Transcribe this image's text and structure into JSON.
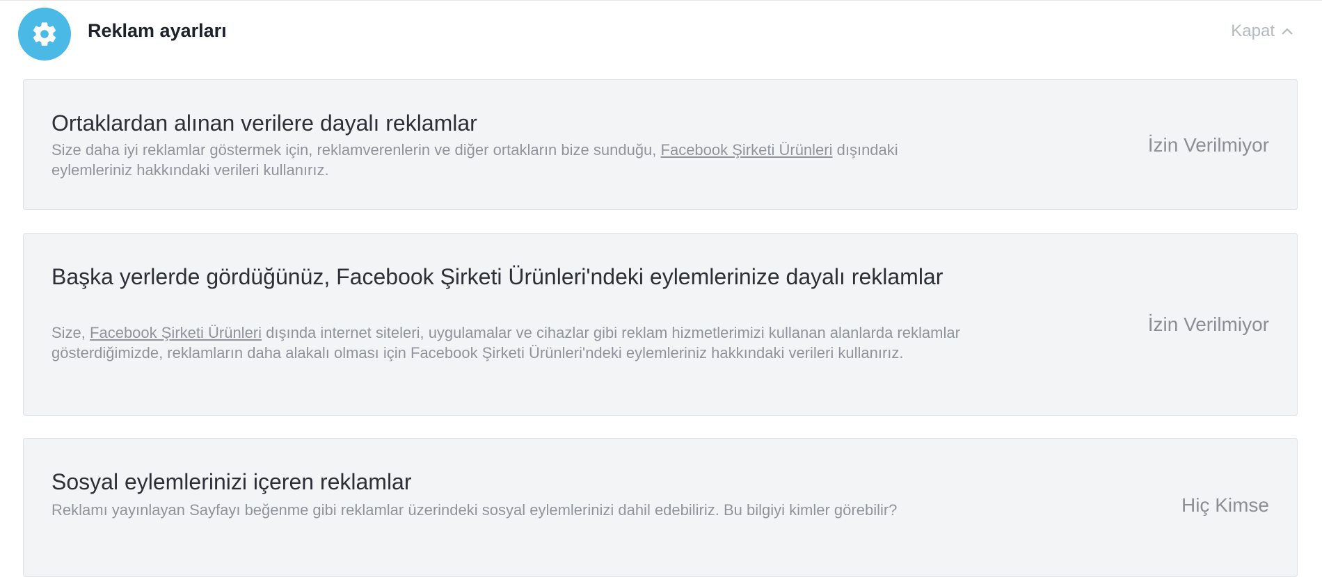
{
  "header": {
    "title": "Reklam ayarları",
    "collapse_label": "Kapat",
    "icon": "gear-icon",
    "accent_color": "#4ab9e6"
  },
  "cards": [
    {
      "title": "Ortaklardan alınan verilere dayalı reklamlar",
      "desc_before": "Size daha iyi reklamlar göstermek için, reklamverenlerin ve diğer ortakların bize sunduğu, ",
      "desc_link": "Facebook Şirketi Ürünleri",
      "desc_after": " dışındaki eylemleriniz hakkındaki verileri kullanırız.",
      "status": "İzin Verilmiyor"
    },
    {
      "title": "Başka yerlerde gördüğünüz, Facebook Şirketi Ürünleri'ndeki eylemlerinize dayalı reklamlar",
      "desc_before": "Size, ",
      "desc_link": "Facebook Şirketi Ürünleri",
      "desc_after": " dışında internet siteleri, uygulamalar ve cihazlar gibi reklam hizmetlerimizi kullanan alanlarda reklamlar gösterdiğimizde, reklamların daha alakalı olması için Facebook Şirketi Ürünleri'ndeki eylemleriniz hakkındaki verileri kullanırız.",
      "status": "İzin Verilmiyor"
    },
    {
      "title": "Sosyal eylemlerinizi içeren reklamlar",
      "desc": "Reklamı yayınlayan Sayfayı beğenme gibi reklamlar üzerindeki sosyal eylemlerinizi dahil edebiliriz. Bu bilgiyi kimler görebilir?",
      "status": "Hiç Kimse"
    }
  ]
}
